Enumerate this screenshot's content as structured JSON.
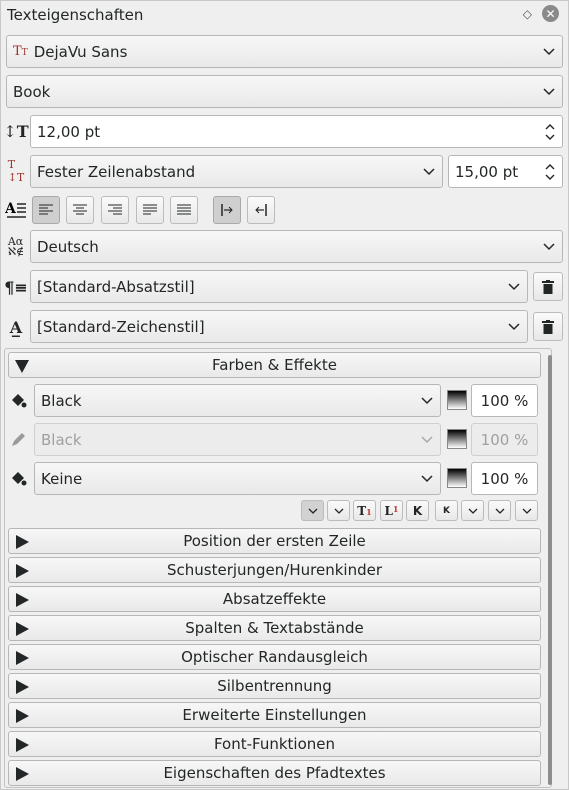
{
  "panel": {
    "title": "Texteigenschaften"
  },
  "font": {
    "family": "DejaVu Sans",
    "style": "Book",
    "size": "12,00 pt"
  },
  "spacing": {
    "mode": "Fester Zeilenabstand",
    "value": "15,00 pt"
  },
  "language": "Deutsch",
  "paragraph_style": "[Standard-Absatzstil]",
  "char_style": "[Standard-Zeichenstil]",
  "colors": {
    "section_title": "Farben & Effekte",
    "fill": {
      "color": "Black",
      "opacity": "100 %"
    },
    "stroke": {
      "color": "Black",
      "opacity": "100 %"
    },
    "background": {
      "color": "Keine",
      "opacity": "100 %"
    }
  },
  "style_buttons": [
    "K",
    "K"
  ],
  "sections": [
    "Position der ersten Zeile",
    "Schusterjungen/Hurenkinder",
    "Absatzeffekte",
    "Spalten & Textabstände",
    "Optischer Randausgleich",
    "Silbentrennung",
    "Erweiterte Einstellungen",
    "Font-Funktionen",
    "Eigenschaften des Pfadtextes"
  ]
}
